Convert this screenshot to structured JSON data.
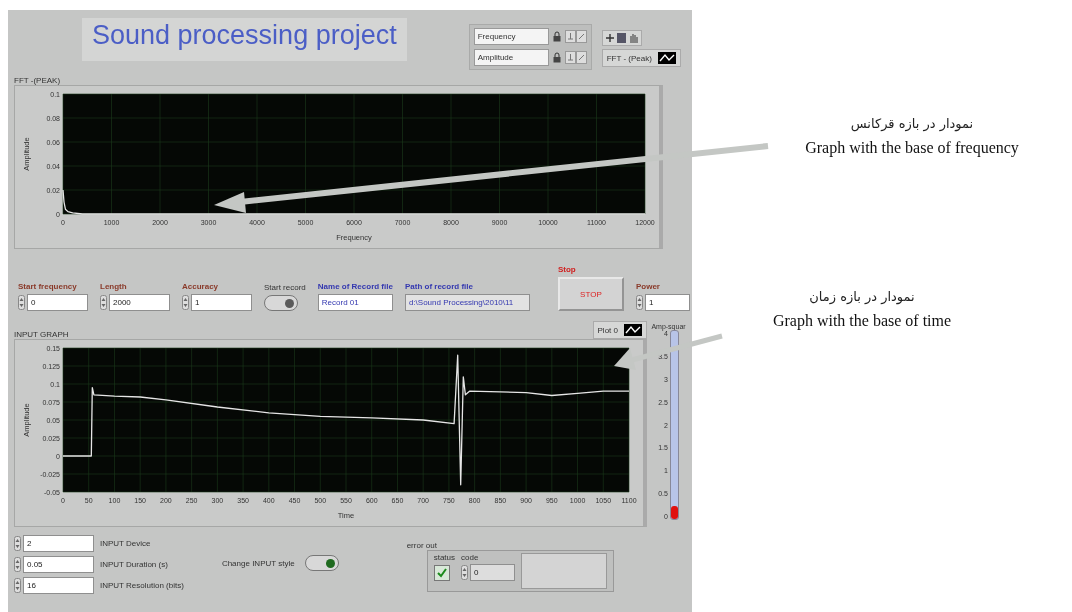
{
  "panel": {
    "title": "Sound processing project",
    "scale_fields": [
      {
        "name": "Frequency"
      },
      {
        "name": "Amplitude"
      }
    ],
    "fft_graph": {
      "label": "FFT -(PEAK)",
      "chart_data": {
        "type": "line",
        "grid": true,
        "xlabel": "Frequency",
        "ylabel": "Amplitude",
        "xlim": [
          0,
          12000
        ],
        "ylim": [
          0,
          0.1
        ],
        "xticks": [
          0,
          1000,
          2000,
          3000,
          4000,
          5000,
          6000,
          7000,
          8000,
          9000,
          10000,
          11000,
          12000
        ],
        "yticks": [
          0,
          0.02,
          0.04,
          0.06,
          0.08,
          0.1
        ],
        "x": [
          0,
          20,
          50,
          100,
          200,
          400,
          800,
          2000,
          6000,
          12000
        ],
        "series": [
          {
            "name": "FFT - (Peak)",
            "color": "#e6e6e6",
            "values": [
              0.02,
              0.01,
              0.004,
              0.002,
              0.001,
              0,
              0,
              0,
              0,
              0
            ]
          }
        ]
      }
    },
    "controls": [
      {
        "kind": "numeric",
        "label": "Start frequency",
        "value": "0"
      },
      {
        "kind": "numeric",
        "label": "Length",
        "value": "2000"
      },
      {
        "kind": "numeric",
        "label": "Accuracy",
        "value": "1"
      },
      {
        "kind": "toggle",
        "label": "Start record",
        "on": true
      },
      {
        "kind": "string",
        "label": "Name of Record file",
        "value": "Record 01"
      },
      {
        "kind": "path",
        "label": "Path of record file",
        "value": "d:\\Sound Processing\\2010\\11"
      },
      {
        "kind": "stop",
        "label": "Stop",
        "caption": "STOP"
      },
      {
        "kind": "numeric",
        "label": "Power",
        "value": "1"
      }
    ],
    "input_graph": {
      "label": "INPUT GRAPH",
      "chart_data": {
        "type": "line",
        "grid": true,
        "xlabel": "Time",
        "ylabel": "Amplitude",
        "xlim": [
          0,
          1100
        ],
        "ylim": [
          -0.05,
          0.15
        ],
        "xticks": [
          0,
          50,
          100,
          150,
          200,
          250,
          300,
          350,
          400,
          450,
          500,
          550,
          600,
          650,
          700,
          750,
          800,
          850,
          900,
          950,
          1000,
          1050,
          1100
        ],
        "yticks": [
          -0.05,
          -0.025,
          0,
          0.025,
          0.05,
          0.075,
          0.1,
          0.125,
          0.15
        ],
        "x": [
          0,
          55,
          57,
          60,
          100,
          150,
          200,
          300,
          400,
          500,
          600,
          700,
          760,
          767,
          773,
          778,
          782,
          790,
          850,
          900,
          950,
          1000,
          1050,
          1100
        ],
        "series": [
          {
            "name": "Plot 0",
            "color": "#e6e6e6",
            "values": [
              0,
              0,
              0.095,
              0.085,
              0.083,
              0.082,
              0.078,
              0.068,
              0.06,
              0.055,
              0.053,
              0.05,
              0.045,
              0.14,
              -0.04,
              0.11,
              0.085,
              0.09,
              0.089,
              0.088,
              0.084,
              0.087,
              0.09,
              0.09
            ]
          }
        ]
      }
    },
    "meter": {
      "label": "Amp-squar",
      "ticks": [
        "4",
        "3.5",
        "3",
        "2.5",
        "2",
        "1.5",
        "1",
        "0.5",
        "0"
      ],
      "level": 0.07
    },
    "input_settings": [
      {
        "label": "INPUT Device",
        "value": "2"
      },
      {
        "label": "INPUT Duration (s)",
        "value": "0.05"
      },
      {
        "label": "INPUT Resolution (bits)",
        "value": "16"
      }
    ],
    "style_toggle": {
      "label": "Change INPUT style",
      "on": true
    },
    "error_out": {
      "label": "error out",
      "status_label": "status",
      "status_ok": true,
      "code_label": "code",
      "code": "0"
    }
  },
  "annotations": [
    {
      "persian": "نمودار در بازه قرکانس",
      "english": "Graph with the base of frequency"
    },
    {
      "persian": "نمودار در بازه زمان",
      "english": "Graph with the base of time"
    }
  ]
}
